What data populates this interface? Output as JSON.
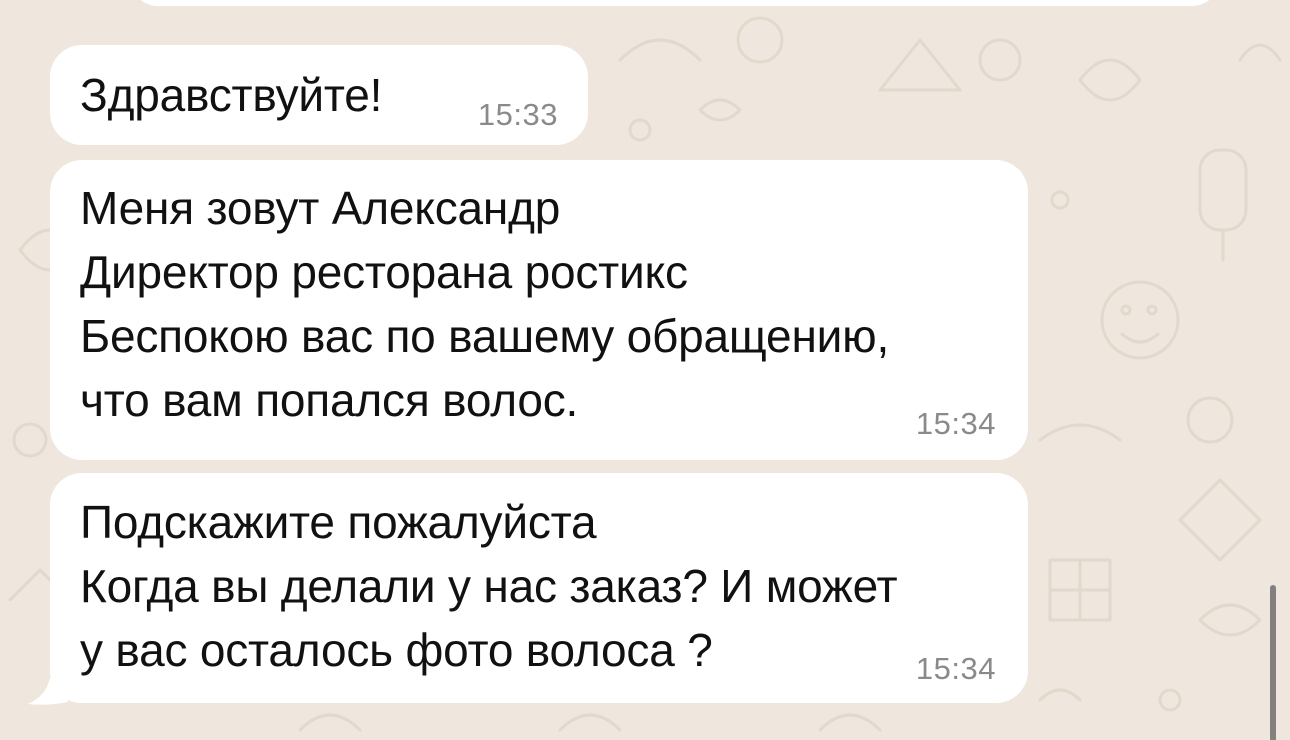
{
  "messages": [
    {
      "text": "Здравствуйте!",
      "time": "15:33"
    },
    {
      "text": "Меня зовут Александр\nДиректор ресторана ростикс\nБеспокою вас по вашему обращению,\nчто вам попался волос.",
      "time": "15:34"
    },
    {
      "text": "Подскажите пожалуйста\nКогда вы делали у нас заказ? И может\nу вас осталось фото волоса ?",
      "time": "15:34"
    }
  ],
  "colors": {
    "background": "#efe7de",
    "bubble": "#ffffff",
    "timestamp": "#8a8a8a",
    "doodle": "#e2d8cb"
  },
  "icons": [
    "chat-wallpaper-doodles",
    "bubble-tail-icon",
    "scrollbar-thumb"
  ]
}
